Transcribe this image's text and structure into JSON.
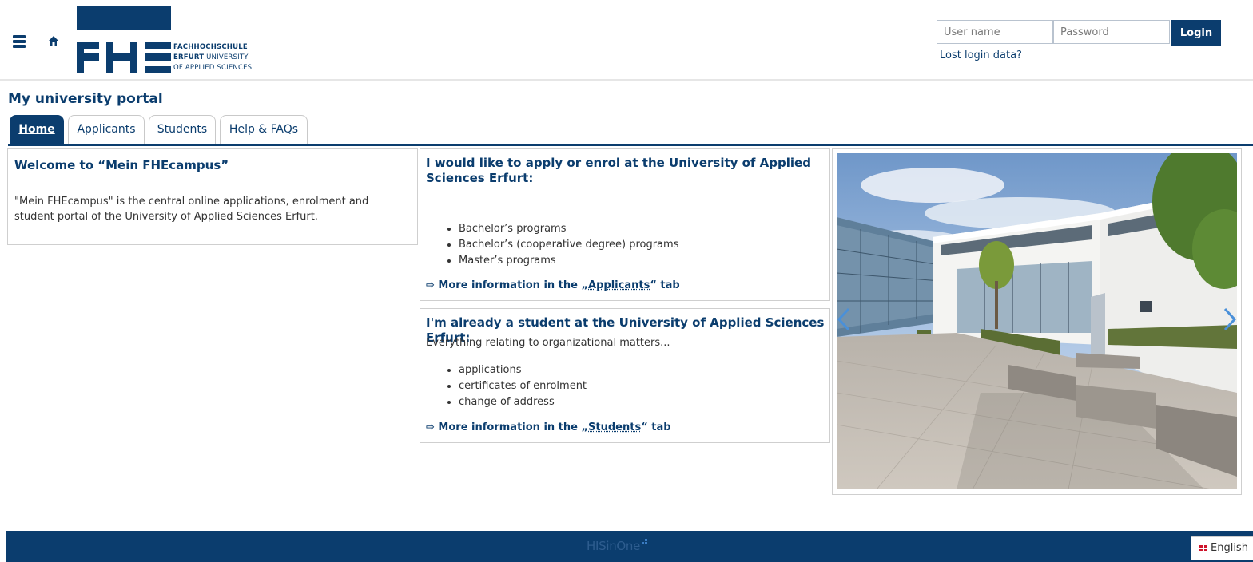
{
  "header": {
    "logo": {
      "line1": "FACHHOCHSCHULE",
      "line2_bold": "ERFURT",
      "line2_rest": " UNIVERSITY",
      "line3": "OF APPLIED SCIENCES",
      "letters": "FHE"
    },
    "login": {
      "username_placeholder": "User name",
      "password_placeholder": "Password",
      "button_label": "Login",
      "lost_link": "Lost login data?"
    }
  },
  "page_title": "My university portal",
  "tabs": [
    {
      "label": "Home",
      "active": true
    },
    {
      "label": "Applicants",
      "active": false
    },
    {
      "label": "Students",
      "active": false
    },
    {
      "label": "Help & FAQs",
      "active": false
    }
  ],
  "welcome": {
    "heading": "Welcome to “Mein FHEcampus”",
    "body": "\"Mein FHEcampus\" is the central online applications, enrolment and student portal of the University of Applied Sciences Erfurt."
  },
  "apply": {
    "heading": "I would like to apply or enrol at the University of Applied Sciences Erfurt:",
    "items": [
      "Bachelor’s programs",
      "Bachelor’s (cooperative degree) programs",
      "Master’s programs"
    ],
    "more_prefix": "⇨ More information in the „",
    "more_link": "Applicants",
    "more_suffix": "“ tab"
  },
  "student": {
    "heading": "I'm already a student at the University of Applied Sciences Erfurt:",
    "subtitle": "Everything relating to organizational matters...",
    "items": [
      "applications",
      "certificates of enrolment",
      "change of address"
    ],
    "more_prefix": "⇨ More information in the „",
    "more_link": "Students",
    "more_suffix": "“ tab"
  },
  "footer": {
    "brand": "HISinOne",
    "language": "English"
  },
  "colors": {
    "brand": "#0b3d6e",
    "border": "#cfcfcf"
  }
}
